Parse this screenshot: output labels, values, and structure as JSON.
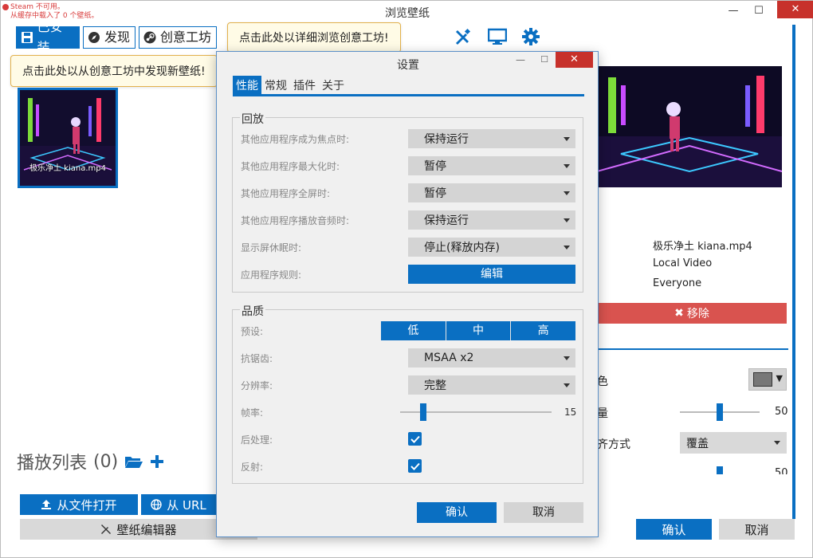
{
  "window": {
    "title": "浏览壁纸",
    "minimize": "—",
    "maximize": "☐",
    "close": "✕"
  },
  "steam_warning": {
    "line1": "Steam 不可用。",
    "line2": "从缓存中载入了 0 个壁纸。"
  },
  "tabs": {
    "installed": "已安装",
    "discover": "发现",
    "workshop": "创意工坊"
  },
  "tooltips": {
    "workshop": "点击此处以详细浏览创意工坊!",
    "discover": "点击此处以从创意工坊中发现新壁纸!"
  },
  "wallpaper": {
    "thumb_caption": "极乐净土 kiana.mp4"
  },
  "playlist": {
    "label": "播放列表",
    "count": "(0)"
  },
  "buttons": {
    "open_file": "从文件打开",
    "open_url": "从 URL",
    "wallpaper_editor": "壁纸编辑器",
    "ok": "确认",
    "cancel": "取消"
  },
  "details": {
    "name": "极乐净土 kiana.mp4",
    "type": "Local Video",
    "rating": "Everyone",
    "remove": "移除"
  },
  "properties": {
    "color_label": "色",
    "volume_label": "量",
    "volume_value": 50,
    "align_label": "齐方式",
    "align_value": "覆盖",
    "partial_value": "50"
  },
  "settings": {
    "title": "设置",
    "tabs": [
      "性能",
      "常规",
      "插件",
      "关于"
    ],
    "playback": {
      "title": "回放",
      "rows": [
        {
          "label": "其他应用程序成为焦点时:",
          "value": "保持运行"
        },
        {
          "label": "其他应用程序最大化时:",
          "value": "暂停"
        },
        {
          "label": "其他应用程序全屏时:",
          "value": "暂停"
        },
        {
          "label": "其他应用程序播放音频时:",
          "value": "保持运行"
        },
        {
          "label": "显示屏休眠时:",
          "value": "停止(释放内存)"
        }
      ],
      "rules_label": "应用程序规则:",
      "edit": "编辑"
    },
    "quality": {
      "title": "品质",
      "preset_label": "预设:",
      "presets": [
        "低",
        "中",
        "高"
      ],
      "aa_label": "抗锯齿:",
      "aa_value": "MSAA x2",
      "resolution_label": "分辨率:",
      "resolution_value": "完整",
      "fps_label": "帧率:",
      "fps_value": "15",
      "fps_fraction": 0.15,
      "postprocess_label": "后处理:",
      "reflection_label": "反射:"
    },
    "ok": "确认",
    "cancel": "取消"
  }
}
